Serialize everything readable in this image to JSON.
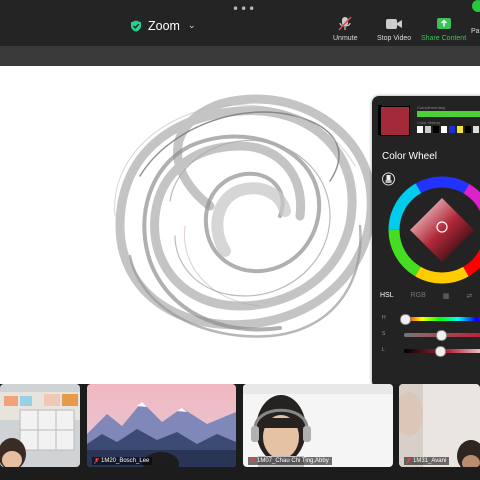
{
  "toolbar": {
    "title": "Zoom",
    "unmute_label": "Unmute",
    "stop_video_label": "Stop Video",
    "share_content_label": "Share Content",
    "partial_label": "Pa"
  },
  "color_panel": {
    "title": "Color Wheel",
    "complementary_label": "Complementary",
    "history_label": "Color History",
    "current_color": "#a32b39",
    "complementary_color": "#4cd137",
    "tabs": [
      "HSL",
      "RGB",
      "Grid",
      "Mix"
    ],
    "sliders": [
      {
        "label": "H",
        "value": 0
      },
      {
        "label": "S",
        "value": 0.42
      },
      {
        "label": "L",
        "value": 0.4
      }
    ]
  },
  "participants": [
    {
      "name": "",
      "muted": true
    },
    {
      "name": "1M20_Bosch_Lee",
      "muted": true
    },
    {
      "name": "1M07_Chau Chi Ting,Abby",
      "muted": true
    },
    {
      "name": "1M31_Avani",
      "muted": true
    }
  ],
  "colors": {
    "topbar": "#242424",
    "share_green": "#3cc15a",
    "canvas": "#ffffff"
  }
}
